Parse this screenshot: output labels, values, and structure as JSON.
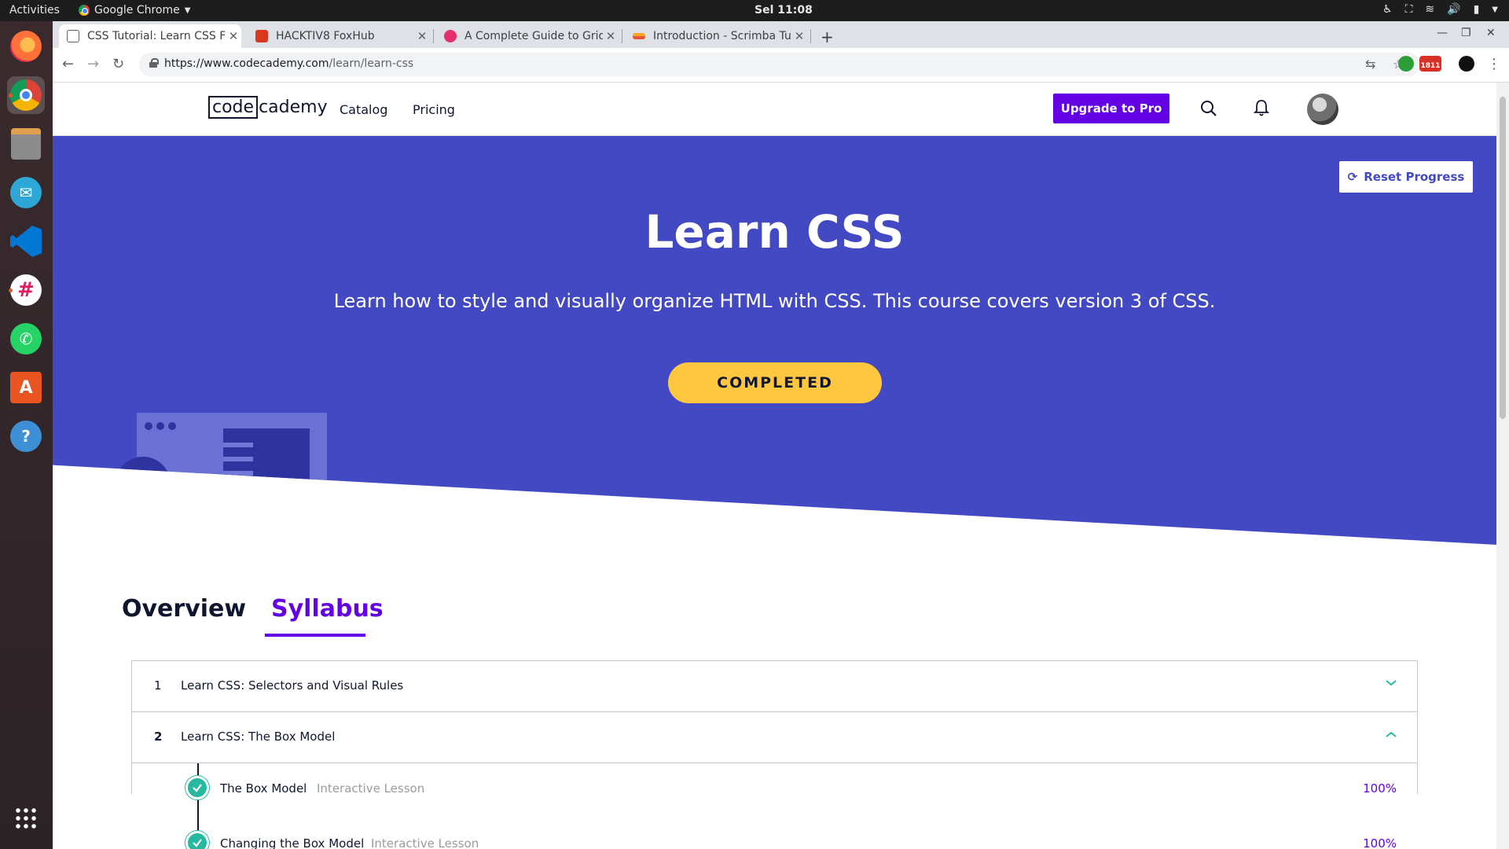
{
  "os": {
    "activities": "Activities",
    "app_menu": "Google Chrome",
    "clock": "Sel 11:08"
  },
  "browser": {
    "tabs": [
      {
        "title": "CSS Tutorial: Learn CSS Fo",
        "active": true
      },
      {
        "title": "HACKTIV8 FoxHub",
        "active": false
      },
      {
        "title": "A Complete Guide to Grid",
        "active": false
      },
      {
        "title": "Introduction - Scrimba Tu",
        "active": false
      }
    ],
    "url_host": "https://www.codecademy.com",
    "url_path": "/learn/learn-css",
    "badge_count": "1811"
  },
  "header": {
    "logo_code": "code",
    "logo_cademy": "cademy",
    "nav": [
      "Catalog",
      "Pricing"
    ],
    "upgrade_label": "Upgrade to Pro"
  },
  "hero": {
    "reset_label": "Reset Progress",
    "title": "Learn CSS",
    "description": "Learn how to style and visually organize HTML with CSS. This course covers version 3 of CSS.",
    "status_label": "COMPLETED"
  },
  "tabs": {
    "overview": "Overview",
    "syllabus": "Syllabus"
  },
  "syllabus": {
    "modules": [
      {
        "number": "1",
        "title": "Learn CSS: Selectors and Visual Rules",
        "expanded": false
      },
      {
        "number": "2",
        "title": "Learn CSS: The Box Model",
        "expanded": true
      }
    ],
    "lessons": [
      {
        "title": "The Box Model",
        "type": "Interactive Lesson",
        "progress": "100%"
      },
      {
        "title": "Changing the Box Model",
        "type": "Interactive Lesson",
        "progress": "100%"
      }
    ]
  },
  "colors": {
    "hero_bg": "#4349c2",
    "accent_purple": "#6400e4",
    "completed_yellow": "#ffc740",
    "check_teal": "#27b8a2"
  }
}
